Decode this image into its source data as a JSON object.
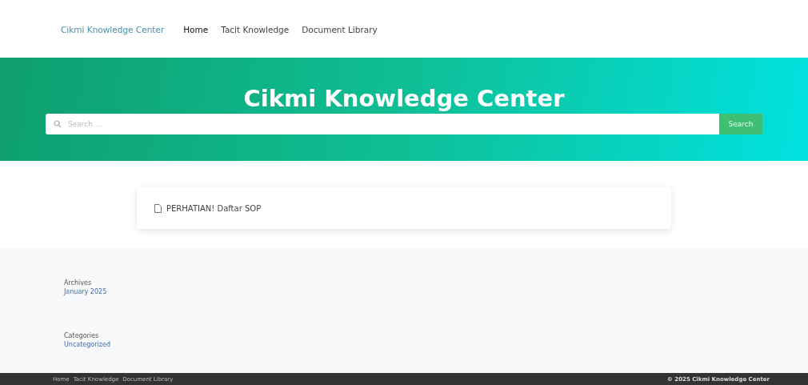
{
  "nav": {
    "brand": "Cikmi Knowledge Center",
    "links": [
      {
        "label": "Home",
        "selected": true
      },
      {
        "label": "Tacit Knowledge",
        "selected": false
      },
      {
        "label": "Document Library",
        "selected": false
      }
    ]
  },
  "hero": {
    "title": "Cikmi Knowledge Center",
    "search": {
      "placeholder": "Search ...",
      "button": "Search"
    }
  },
  "posts": [
    {
      "title": "PERHATIAN! Daftar SOP"
    }
  ],
  "widgets": [
    {
      "heading": "Archives",
      "links": [
        "January 2025"
      ]
    },
    {
      "heading": "Categories",
      "links": [
        "Uncategorized"
      ]
    }
  ],
  "footer": {
    "links": [
      "Home",
      "Tacit Knowledge",
      "Document Library"
    ],
    "copyright": "© 2025 Cikmi Knowledge Center"
  }
}
